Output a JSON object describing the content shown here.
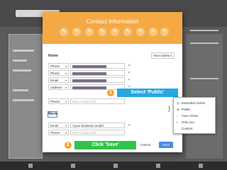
{
  "dialog": {
    "title": "Contact Information"
  },
  "header_icons": [
    "pencil-icon",
    "pencil-icon",
    "pencil-icon",
    "pencil-icon",
    "pencil-icon",
    "pencil-icon",
    "pencil-icon",
    "pencil-icon"
  ],
  "home": {
    "label": "Home",
    "circle_select": "Your circles",
    "rows": [
      {
        "type": "Phone",
        "value": ""
      },
      {
        "type": "Phone",
        "value": ""
      },
      {
        "type": "Email",
        "value": ""
      },
      {
        "type": "Address",
        "value": ""
      },
      {
        "type": "Phone",
        "placeholder": "New contact info"
      }
    ]
  },
  "work": {
    "label": "Work",
    "rows": [
      {
        "type": "Email",
        "value": "<your business email>"
      },
      {
        "type": "Phone",
        "placeholder": "New contact info"
      }
    ]
  },
  "callouts": {
    "step1_number": "1",
    "step1_text": "Select 'Public'",
    "step2_number": "2",
    "step2_text": "Click 'Save'"
  },
  "buttons": {
    "cancel": "Cancel",
    "save": "Save"
  },
  "visibility_menu": {
    "items": [
      "Extended circles",
      "Public",
      "Your circles",
      "Only you",
      "Custom"
    ]
  },
  "colors": {
    "header": "#f4a944",
    "callout_blue": "#26a7e0",
    "callout_green": "#32c24a",
    "save_button": "#4a8de0",
    "badge": "#f2a431"
  }
}
